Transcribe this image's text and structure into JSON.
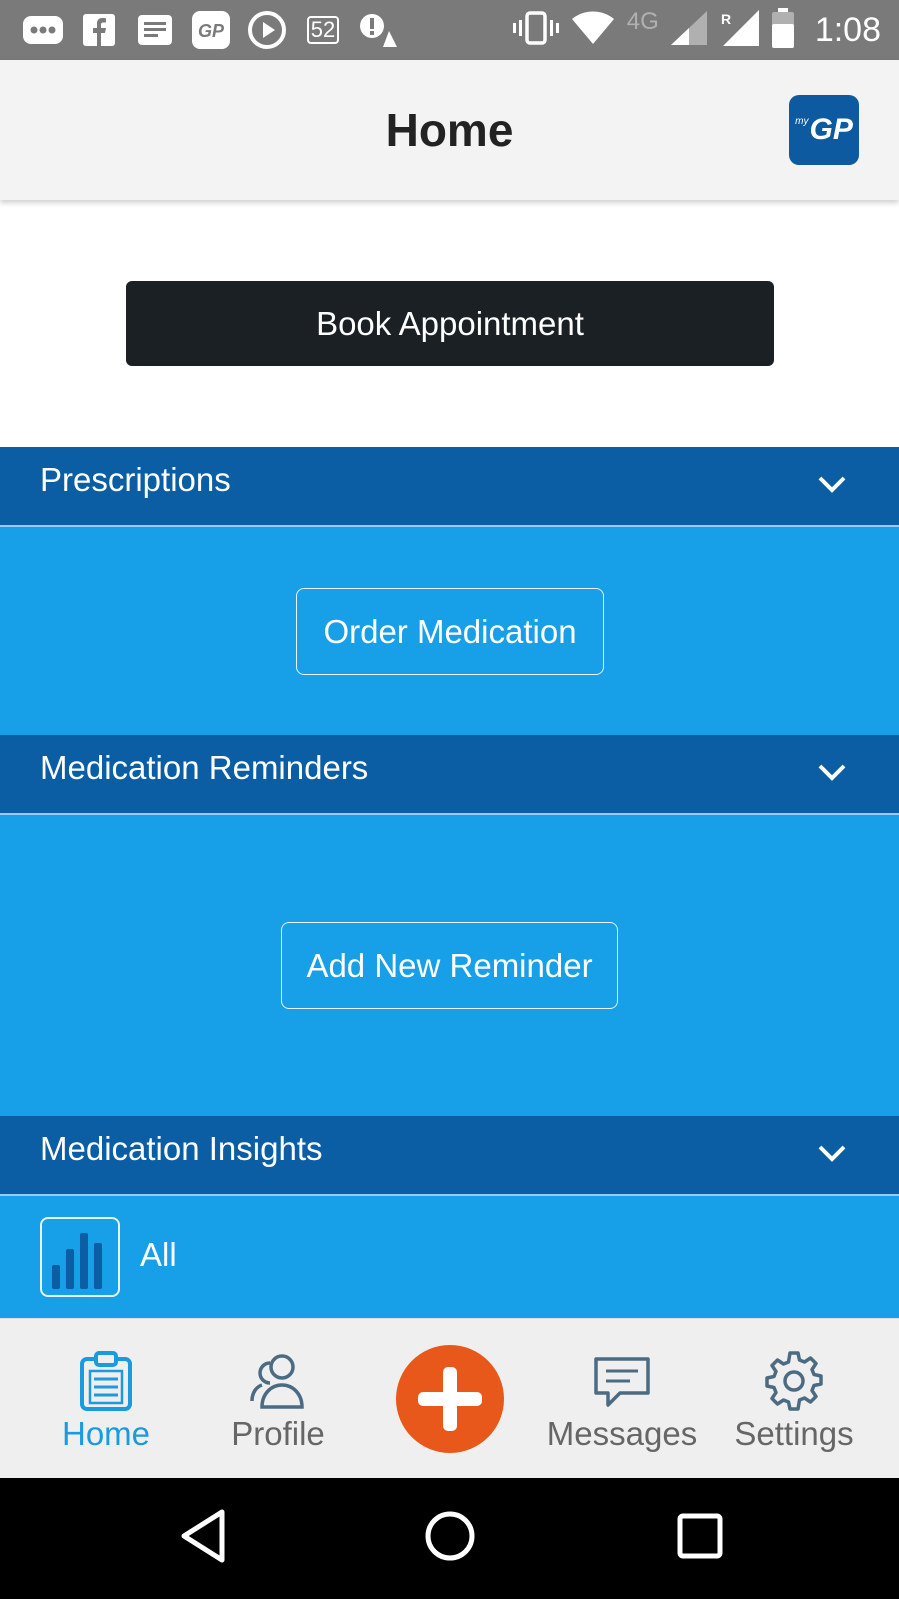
{
  "status_bar": {
    "time": "1:08",
    "network": "4G",
    "notification_count": "52",
    "roaming": "R"
  },
  "header": {
    "title": "Home",
    "logo_text": "GP",
    "logo_sup": "my"
  },
  "actions": {
    "book_label": "Book Appointment"
  },
  "sections": {
    "prescriptions": {
      "title": "Prescriptions",
      "button": "Order Medication"
    },
    "reminders": {
      "title": "Medication Reminders",
      "button": "Add New Reminder"
    },
    "insights": {
      "title": "Medication Insights",
      "item": "All"
    }
  },
  "bottom_nav": {
    "home": "Home",
    "profile": "Profile",
    "messages": "Messages",
    "settings": "Settings",
    "active": "home"
  },
  "colors": {
    "section_header": "#0b5ea3",
    "section_body": "#17a0e8",
    "accent": "#1a9be0",
    "fab": "#e8581b",
    "book_button": "#1b2024"
  },
  "icons": {
    "add": "plus-icon",
    "home": "clipboard-icon",
    "profile": "users-icon",
    "messages": "chat-icon",
    "settings": "gear-icon"
  }
}
